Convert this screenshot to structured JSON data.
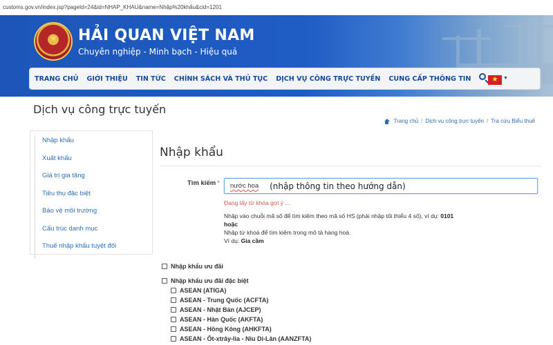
{
  "browser": {
    "url": "customs.gov.vn/index.jsp?pageId=24&id=NHAP_KHAU&name=Nhập%20khẩu&cid=1201"
  },
  "header": {
    "title": "HẢI QUAN VIỆT NAM",
    "slogan": "Chuyên nghiệp - Minh bạch - Hiệu quả",
    "logo_icon": "customs-emblem-icon",
    "flag_icon": "vietnam-flag-icon"
  },
  "nav": {
    "items": [
      "TRANG CHỦ",
      "GIỚI THIỆU",
      "TIN TỨC",
      "CHÍNH SÁCH VÀ THỦ TỤC",
      "DỊCH VỤ CÔNG TRỰC TUYẾN",
      "CUNG CẤP THÔNG TIN"
    ],
    "search_icon": "search-icon"
  },
  "page": {
    "heading": "Dịch vụ công trực tuyến",
    "breadcrumb": [
      "Trang chủ",
      "Dịch vụ công trực tuyến",
      "Tra cứu Biểu thuế"
    ]
  },
  "sidebar": {
    "items": [
      "Nhập khẩu",
      "Xuất khẩu",
      "Giá trị gia tăng",
      "Tiêu thụ đặc biệt",
      "Bảo vệ môi trường",
      "Cấu trúc danh mục",
      "Thuế nhập khẩu tuyệt đối"
    ]
  },
  "main": {
    "title": "Nhập khẩu",
    "search": {
      "label": "Tìm kiếm",
      "required_mark": "*",
      "value": "nước hoa",
      "hint": "(nhập thông tin theo hướng dẫn)",
      "loading": "Đang lấy từ khóa gợi ý ...",
      "help_line1": "Nhập vào chuỗi mã số để tìm kiếm theo mã số HS (phải nhập tối thiểu 4 số), ví dụ: ",
      "help_example1": "0101",
      "help_or": "hoặc",
      "help_line2": "Nhập từ khoá để tìm kiếm trong mô tả hàng hoá.",
      "help_example_label": "Ví dụ: ",
      "help_example2": "Gia cầm"
    },
    "checkboxes": {
      "preferential": "Nhập khẩu ưu đãi",
      "special_preferential": "Nhập khẩu ưu đãi đặc biệt",
      "agreements": [
        "ASEAN (ATIGA)",
        "ASEAN - Trung Quốc (ACFTA)",
        "ASEAN - Nhật Bản (AJCEP)",
        "ASEAN - Hàn Quốc (AKFTA)",
        "ASEAN - Hồng Kông (AHKFTA)",
        "ASEAN - Ốt-xtrây-lia - Niu Di-Lân (AANZFTA)"
      ]
    }
  },
  "colors": {
    "header_blue": "#1d56b8",
    "nav_text": "#16489c",
    "link": "#2a6eb5",
    "warning": "#d9534f"
  }
}
